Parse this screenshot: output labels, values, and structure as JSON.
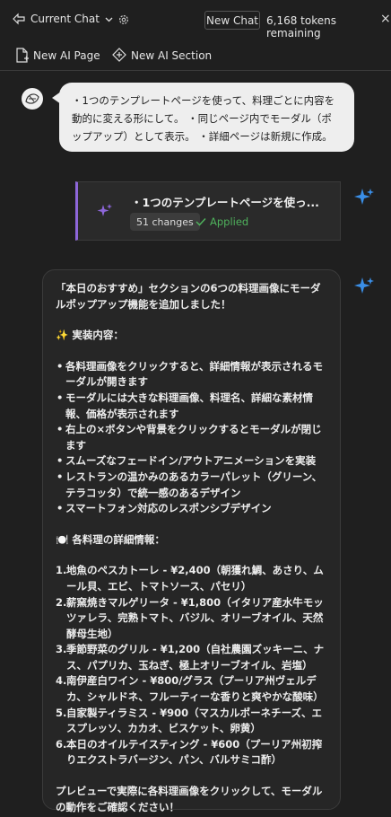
{
  "header": {
    "chat_selector": "Current Chat",
    "new_chat": "New Chat",
    "tokens": "6,168 tokens remaining",
    "close": "×"
  },
  "toolbar": {
    "new_page": "New AI Page",
    "new_section": "New AI Section"
  },
  "user_message": {
    "text": "・1つのテンプレートページを使って、料理ごとに内容を動的に変える形にして。 ・同じページ内でモーダル（ポップアップ）として表示。 ・詳細ページは新規に作成。"
  },
  "changes_card": {
    "title": "・1つのテンプレートページを使っ...",
    "changes": "51 changes",
    "status": "Applied"
  },
  "ai_message": {
    "intro": "「本日のおすすめ」セクションの6つの料理画像にモーダルポップアップ機能を追加しました！",
    "impl_heading": "✨ 実装内容：",
    "impl_items": [
      "各料理画像をクリックすると、詳細情報が表示されるモーダルが開きます",
      "モーダルには大きな料理画像、料理名、詳細な素材情報、価格が表示されます",
      "右上の×ボタンや背景をクリックするとモーダルが閉じます",
      "スムーズなフェードイン/アウトアニメーションを実装",
      "レストランの温かみのあるカラーパレット（グリーン、テラコッタ）で統一感のあるデザイン",
      "スマートフォン対応のレスポンシブデザイン"
    ],
    "detail_heading": "🍽️ 各料理の詳細情報：",
    "detail_items": [
      "地魚のペスカトーレ - ¥2,400（朝獲れ鯛、あさり、ムール貝、エビ、トマトソース、パセリ）",
      "薪窯焼きマルゲリータ - ¥1,800（イタリア産水牛モッツァレラ、完熟トマト、バジル、オリーブオイル、天然酵母生地）",
      "季節野菜のグリル - ¥1,200（自社農園ズッキーニ、ナス、パプリカ、玉ねぎ、極上オリーブオイル、岩塩）",
      "南伊産白ワイン - ¥800/グラス（プーリア州ヴェルデカ、シャルドネ、フルーティーな香りと爽やかな酸味）",
      "自家製ティラミス - ¥900（マスカルポーネチーズ、エスプレッソ、カカオ、ビスケット、卵黄）",
      "本日のオイルテイスティング - ¥600（プーリア州初搾りエクストラバージン、パン、バルサミコ酢）"
    ],
    "detail_numbers": [
      "1.",
      "2.",
      "3.",
      "4.",
      "5.",
      "6."
    ],
    "outro": "プレビューで実際に各料理画像をクリックして、モーダルの動作をご確認ください！"
  },
  "colors": {
    "background": "#1f1f1f",
    "accent_purple": "#8d66d9",
    "applied_green": "#4fb15c",
    "sparkle_blue": "#3a8ee6"
  },
  "icons": [
    "chevron-down-icon",
    "gear-icon",
    "new-page-icon",
    "new-section-icon",
    "user-avatar",
    "sparkle-icon",
    "check-icon"
  ]
}
